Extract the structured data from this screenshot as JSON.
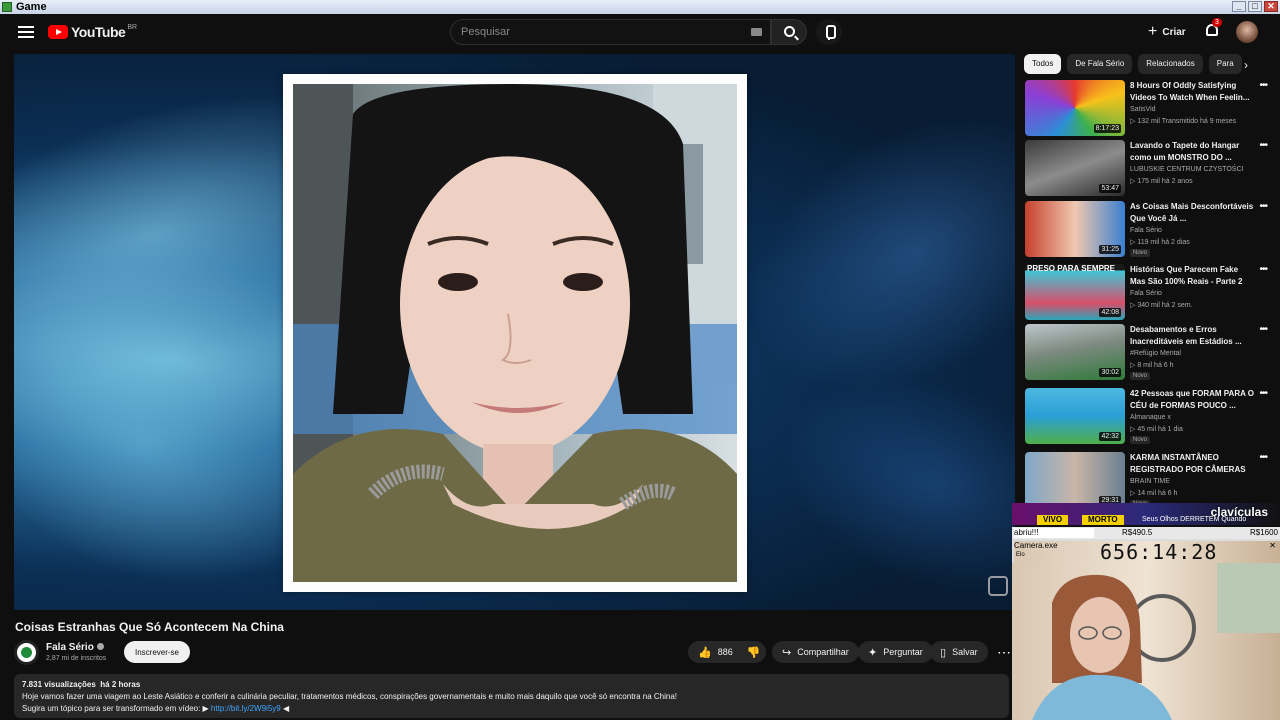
{
  "window": {
    "title": "Game"
  },
  "header": {
    "logo_text": "YouTube",
    "country_code": "BR",
    "search_placeholder": "Pesquisar",
    "create_label": "Criar",
    "notifications_count": "3"
  },
  "video": {
    "title": "Coisas Estranhas Que Só Acontecem Na China",
    "channel_name": "Fala Sério",
    "subscribers": "2,87 mi de inscritos",
    "subscribe_label": "Inscrever-se",
    "likes": "886",
    "share_label": "Compartilhar",
    "ask_label": "Perguntar",
    "save_label": "Salvar",
    "views": "7.831 visualizações",
    "published": "há 2 horas",
    "description_line1": "Hoje vamos fazer uma viagem ao Leste Asiático e conferir a culinária peculiar, tratamentos médicos, conspirações governamentais e muito mais daquilo que você só encontra na China!",
    "description_line2_prefix": "Sugira um tópico para ser transformado em vídeo: ▶",
    "description_link": "http://bit.ly/2W9i5y9",
    "description_line2_suffix": "◀"
  },
  "chips": [
    "Todos",
    "De Fala Sério",
    "Relacionados",
    "Para"
  ],
  "recommendations": [
    {
      "title": "8 Hours Of Oddly Satisfying Videos To Watch When Feelin...",
      "channel": "SatisVid",
      "meta": "132 mil   Transmitido há 9 meses",
      "duration": "8:17:23",
      "new": ""
    },
    {
      "title": "Lavando o Tapete do Hangar como um MONSTRO DO ...",
      "channel": "LUBUSKIE CENTRUM CZYSTOŚCI",
      "meta": "175 mil   há 2 anos",
      "duration": "53:47",
      "new": ""
    },
    {
      "title": "As Coisas Mais Desconfortáveis Que Você Já ...",
      "channel": "Fala Sério",
      "meta": "119 mil   há 2 dias",
      "duration": "31:25",
      "new": "Novo"
    },
    {
      "title": "Histórias Que Parecem Fake Mas São 100% Reais - Parte 2",
      "channel": "Fala Sério",
      "meta": "340 mil   há 2 sem.",
      "duration": "42:08",
      "new": ""
    },
    {
      "title": "Desabamentos e Erros Inacreditáveis em Estádios ...",
      "channel": "#Refúgio Mental",
      "meta": "8 mil   há 6 h",
      "duration": "30:02",
      "new": "Novo"
    },
    {
      "title": "42 Pessoas que FORAM PARA O CÉU de FORMAS POUCO ...",
      "channel": "Almanaque x",
      "meta": "45 mil   há 1 dia",
      "duration": "42:32",
      "new": "Novo"
    },
    {
      "title": "KARMA INSTANTÂNEO REGISTRADO POR CÂMERAS",
      "channel": "BRAIN TIME",
      "meta": "14 mil   há 6 h",
      "duration": "29:31",
      "new": "Novo"
    }
  ],
  "thumb_texts": {
    "preso": "PRESO PARA SEMPRE"
  },
  "overlay": {
    "banner_text": "clavículas",
    "vivo": "VIVO",
    "morto": "MORTO",
    "next_title": "Seus Olhos DERRETEM Quando",
    "split_name": "abriu!!!",
    "split_value": "R$490.5",
    "split_total": "R$1600",
    "camera_label": "Camera.exe",
    "camera_sub": "Elo",
    "timer": "656:14:28"
  },
  "colors": {
    "accent": "#ff0000",
    "link": "#3ea6ff",
    "background": "#0f0f0f"
  }
}
